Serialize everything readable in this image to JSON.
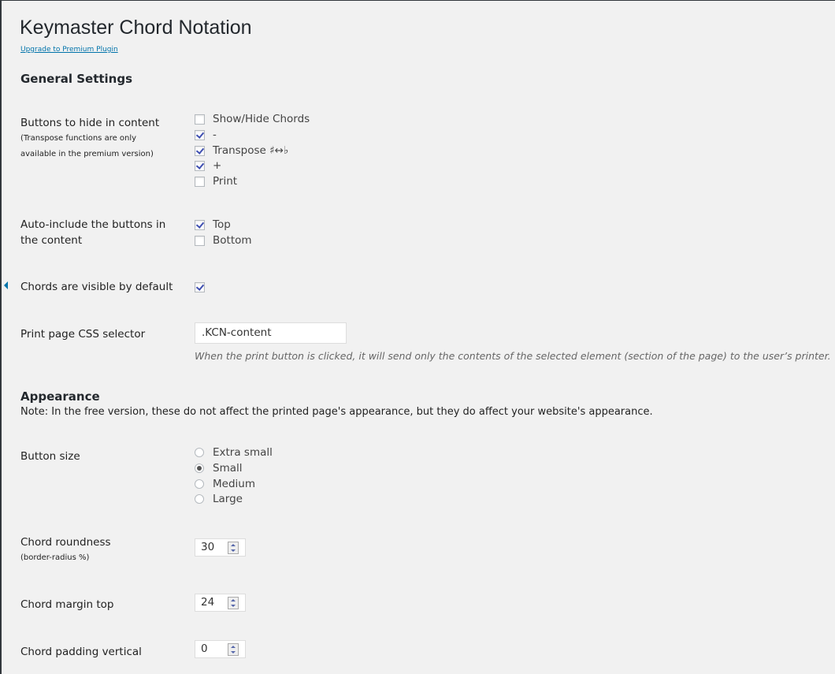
{
  "title": "Keymaster Chord Notation",
  "upgrade_link": "Upgrade to Premium Plugin",
  "general": {
    "heading": "General Settings",
    "hide_buttons": {
      "label": "Buttons to hide in content",
      "sub": "(Transpose functions are only available in the premium version)",
      "options": [
        {
          "label": "Show/Hide Chords",
          "checked": false
        },
        {
          "label": "-",
          "checked": true
        },
        {
          "label": "Transpose ♯↔♭",
          "checked": true
        },
        {
          "label": "+",
          "checked": true
        },
        {
          "label": "Print",
          "checked": false
        }
      ]
    },
    "auto_include": {
      "label": "Auto-include the buttons in the content",
      "options": [
        {
          "label": "Top",
          "checked": true
        },
        {
          "label": "Bottom",
          "checked": false
        }
      ]
    },
    "visible_default": {
      "label": "Chords are visible by default",
      "checked": true
    },
    "print_selector": {
      "label": "Print page CSS selector",
      "value": ".KCN-content",
      "description": "When the print button is clicked, it will send only the contents of the selected element (section of the page) to the user’s printer."
    }
  },
  "appearance": {
    "heading": "Appearance",
    "note": "Note: In the free version, these do not affect the printed page's appearance, but they do affect your website's appearance.",
    "button_size": {
      "label": "Button size",
      "options": [
        "Extra small",
        "Small",
        "Medium",
        "Large"
      ],
      "selected": "Small"
    },
    "roundness": {
      "label": "Chord roundness",
      "sub": "(border-radius %)",
      "value": "30"
    },
    "margin_top": {
      "label": "Chord margin top",
      "value": "24"
    },
    "padding_vertical": {
      "label": "Chord padding vertical",
      "value": "0"
    }
  }
}
